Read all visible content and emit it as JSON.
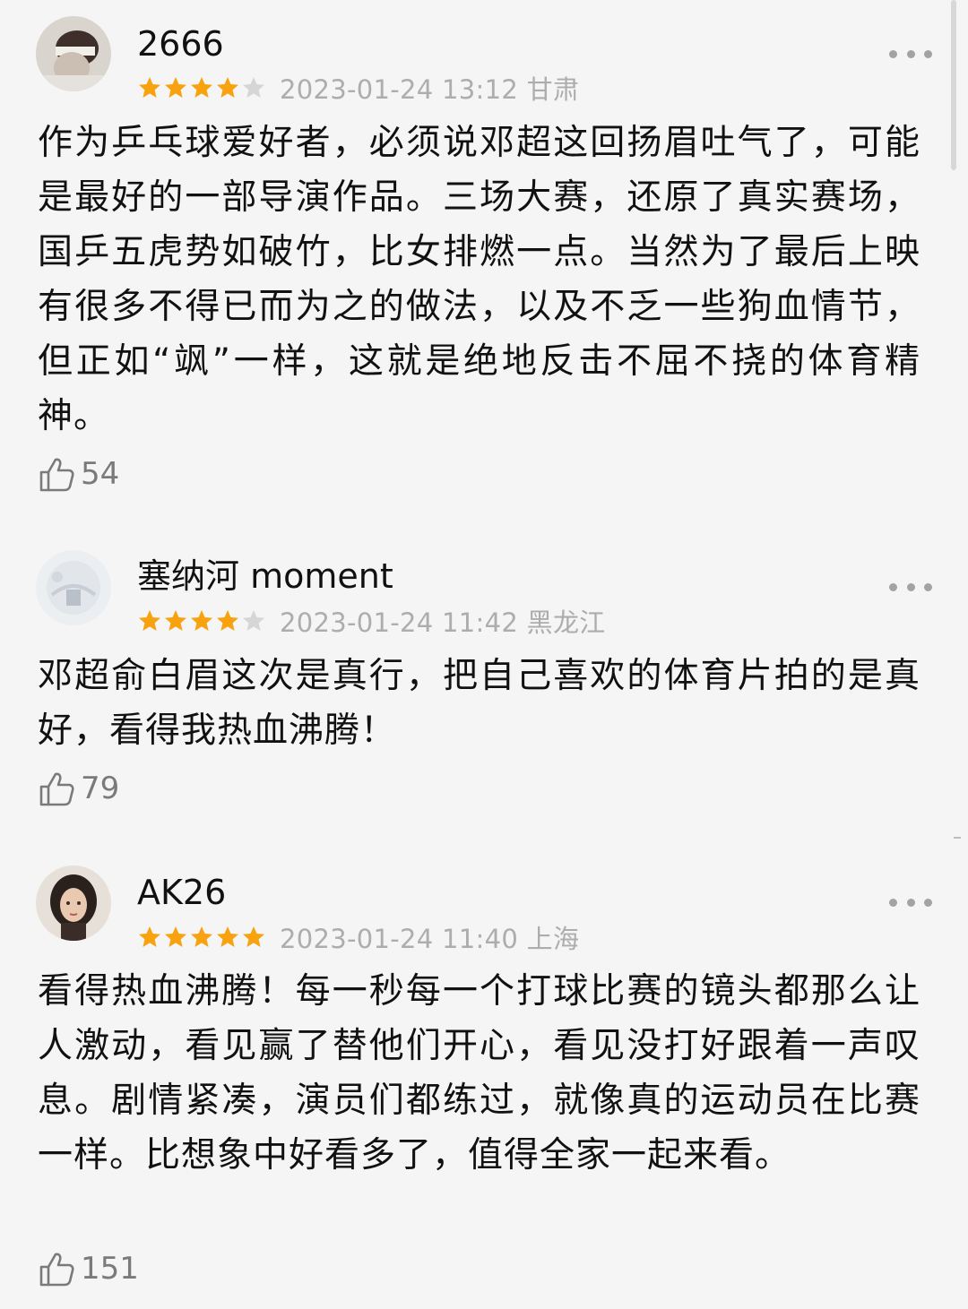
{
  "colors": {
    "background": "#f5f5f5",
    "star_filled": "#f7a20e",
    "star_empty": "#d6d6d6",
    "meta_text": "#adadad",
    "like_icon": "#7a7a7a"
  },
  "reviews": [
    {
      "username": "2666",
      "rating": 4,
      "max_rating": 5,
      "meta": "2023-01-24 13:12 甘肃",
      "text": "作为乒乓球爱好者，必须说邓超这回扬眉吐气了，可能是最好的一部导演作品。三场大赛，还原了真实赛场，国乒五虎势如破竹，比女排燃一点。当然为了最后上映有很多不得已而为之的做法，以及不乏一些狗血情节，但正如“飒”一样，这就是绝地反击不屈不挠的体育精神。",
      "likes": "54"
    },
    {
      "username": "塞纳河 moment",
      "rating": 4,
      "max_rating": 5,
      "meta": "2023-01-24 11:42 黑龙江",
      "text": "邓超俞白眉这次是真行，把自己喜欢的体育片拍的是真好，看得我热血沸腾！",
      "likes": "79"
    },
    {
      "username": "AK26",
      "rating": 5,
      "max_rating": 5,
      "meta": "2023-01-24 11:40 上海",
      "text": "看得热血沸腾！每一秒每一个打球比赛的镜头都那么让人激动，看见赢了替他们开心，看见没打好跟着一声叹息。剧情紧凑，演员们都练过，就像真的运动员在比赛一样。比想象中好看多了，值得全家一起来看。",
      "likes": "151"
    }
  ],
  "icons": {
    "more": "more-dots-icon",
    "like": "thumbs-up-icon",
    "star": "star-icon",
    "avatar": "user-avatar"
  }
}
